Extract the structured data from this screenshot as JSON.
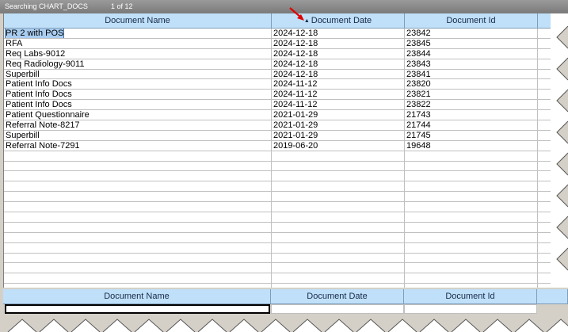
{
  "title": {
    "search_label": "Searching CHART_DOCS",
    "count": "1 of 12"
  },
  "columns": [
    "Document Name",
    "Document Date",
    "Document Id"
  ],
  "sort": {
    "column": "Document Date",
    "indicator": "▲"
  },
  "rows": [
    {
      "name": "PR 2 with POS",
      "date": "2024-12-18",
      "id": "23842"
    },
    {
      "name": "RFA",
      "date": "2024-12-18",
      "id": "23845"
    },
    {
      "name": "Req Labs-9012",
      "date": "2024-12-18",
      "id": "23844"
    },
    {
      "name": "Req Radiology-9011",
      "date": "2024-12-18",
      "id": "23843"
    },
    {
      "name": "Superbill",
      "date": "2024-12-18",
      "id": "23841"
    },
    {
      "name": "Patient Info Docs",
      "date": "2024-11-12",
      "id": "23820"
    },
    {
      "name": "Patient Info Docs",
      "date": "2024-11-12",
      "id": "23821"
    },
    {
      "name": "Patient Info Docs",
      "date": "2024-11-12",
      "id": "23822"
    },
    {
      "name": "Patient Questionnaire",
      "date": "2021-01-29",
      "id": "21743"
    },
    {
      "name": "Referral Note-8217",
      "date": "2021-01-29",
      "id": "21744"
    },
    {
      "name": "Superbill",
      "date": "2021-01-29",
      "id": "21745"
    },
    {
      "name": "Referral Note-7291",
      "date": "2019-06-20",
      "id": "19648"
    }
  ],
  "filter_columns": [
    "Document Name",
    "Document Date",
    "Document Id"
  ],
  "colors": {
    "header_bg": "#bfe0f8",
    "selection": "#a9cdf0",
    "annotation_arrow": "#e00000"
  }
}
